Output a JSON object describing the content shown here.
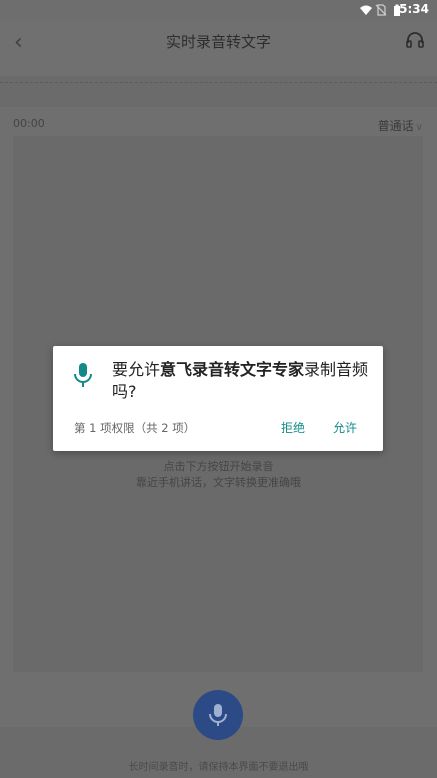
{
  "status_bar": {
    "time": "5:34"
  },
  "app_bar": {
    "title": "实时录音转文字"
  },
  "recording": {
    "elapsed": "00:00",
    "language": "普通话"
  },
  "hints": {
    "line1": "点击下方按钮开始录音",
    "line2": "靠近手机讲话，文字转换更准确哦"
  },
  "footer_note": "长时间录音时，请保持本界面不要退出哦",
  "permission_dialog": {
    "message_prefix": "要允许",
    "app_name": "意飞录音转文字专家",
    "message_suffix": "录制音频吗?",
    "permission_count": "第 1 项权限（共 2 项）",
    "deny_label": "拒绝",
    "allow_label": "允许"
  },
  "colors": {
    "accent": "#138a88",
    "record_button": "#2b4a86"
  }
}
